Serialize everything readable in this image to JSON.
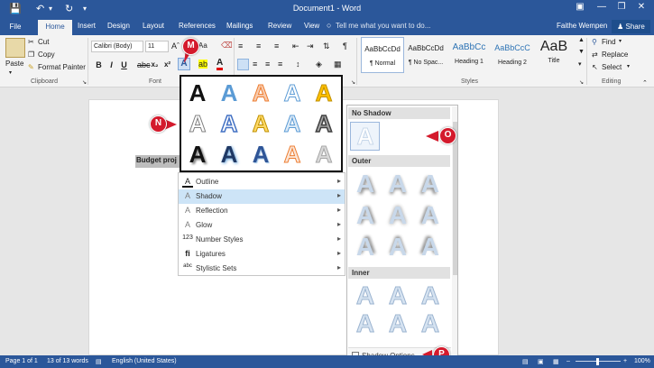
{
  "title_bar": {
    "document_title": "Document1 - Word"
  },
  "tabs": {
    "file": "File",
    "items": [
      "Home",
      "Insert",
      "Design",
      "Layout",
      "References",
      "Mailings",
      "Review",
      "View"
    ],
    "tell_me": "Tell me what you want to do...",
    "user": "Faithe Wempen",
    "share": "Share"
  },
  "ribbon": {
    "clipboard": {
      "paste": "Paste",
      "cut": "Cut",
      "copy": "Copy",
      "format_painter": "Format Painter",
      "label": "Clipboard"
    },
    "font": {
      "name": "Calibri (Body)",
      "size": "11",
      "label": "Font"
    },
    "paragraph": {
      "label": "Paragraph"
    },
    "styles": {
      "label": "Styles",
      "items": [
        {
          "preview": "AaBbCcDd",
          "name": "¶ Normal"
        },
        {
          "preview": "AaBbCcDd",
          "name": "¶ No Spac..."
        },
        {
          "preview": "AaBbCc",
          "name": "Heading 1"
        },
        {
          "preview": "AaBbCcC",
          "name": "Heading 2"
        },
        {
          "preview": "AaB",
          "name": "Title"
        }
      ]
    },
    "editing": {
      "find": "Find",
      "replace": "Replace",
      "select": "Select",
      "label": "Editing"
    }
  },
  "document": {
    "selected_text": "Budget proj"
  },
  "text_effects_menu": {
    "items": [
      {
        "label": "Outline",
        "icon": "outline-icon"
      },
      {
        "label": "Shadow",
        "icon": "shadow-icon"
      },
      {
        "label": "Reflection",
        "icon": "reflection-icon"
      },
      {
        "label": "Glow",
        "icon": "glow-icon"
      },
      {
        "label": "Number Styles",
        "icon": "number-styles-icon"
      },
      {
        "label": "Ligatures",
        "icon": "ligatures-icon"
      },
      {
        "label": "Stylistic Sets",
        "icon": "stylistic-sets-icon"
      }
    ],
    "gallery_glyph": "A"
  },
  "shadow_panel": {
    "no_shadow": "No Shadow",
    "outer": "Outer",
    "inner": "Inner",
    "options": "Shadow Options..."
  },
  "callouts": {
    "m": "M",
    "n": "N",
    "o": "O",
    "p": "P"
  },
  "status_bar": {
    "page": "Page 1 of 1",
    "words": "13 of 13 words",
    "language": "English (United States)",
    "zoom": "100%"
  },
  "colors": {
    "word_blue": "#2b579a",
    "callout_red": "#d41a2c"
  }
}
